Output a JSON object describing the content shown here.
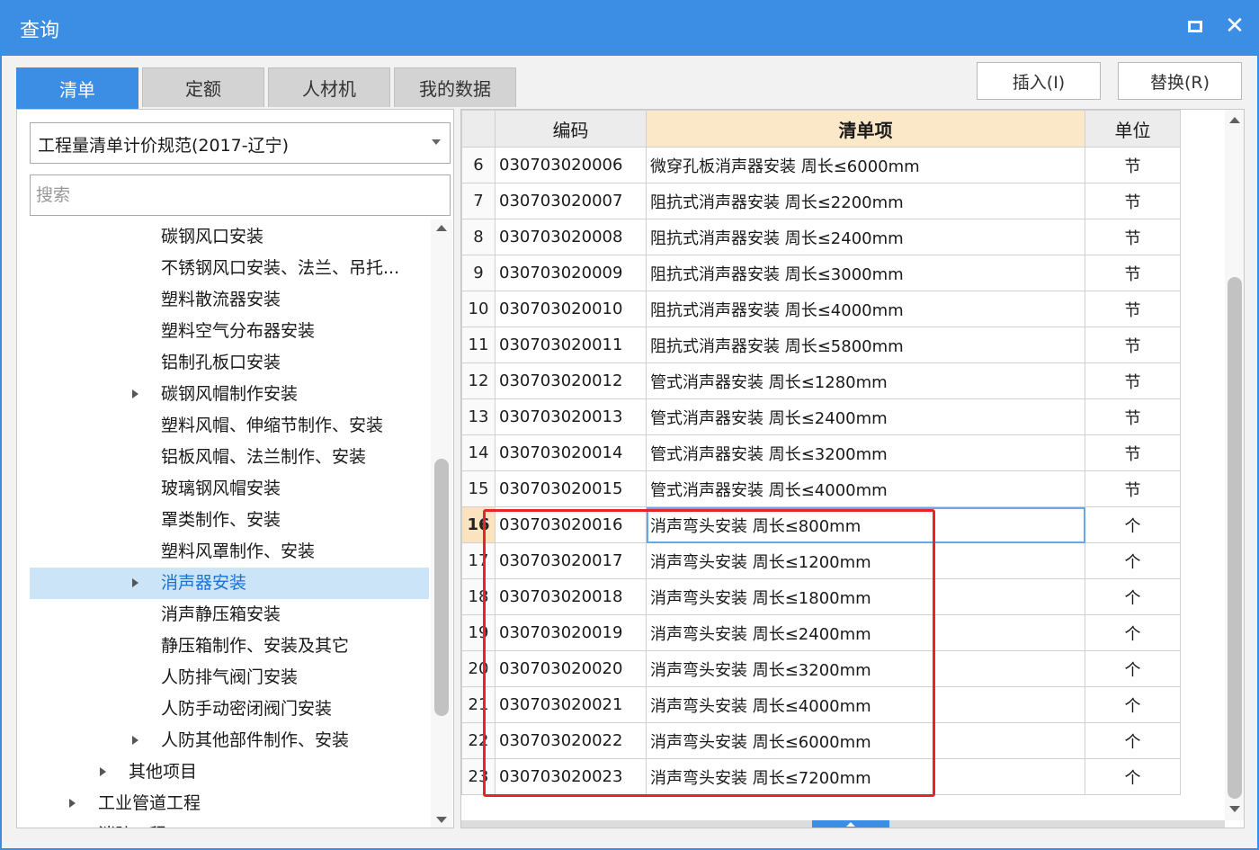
{
  "window": {
    "title": "查询"
  },
  "tabs": [
    {
      "label": "清单",
      "active": true
    },
    {
      "label": "定额",
      "active": false
    },
    {
      "label": "人材机",
      "active": false
    },
    {
      "label": "我的数据",
      "active": false
    }
  ],
  "actions": {
    "insert_label": "插入(I)",
    "replace_label": "替换(R)"
  },
  "left": {
    "spec_selected": "工程量清单计价规范(2017-辽宁)",
    "search_placeholder": "搜索",
    "tree": [
      {
        "label": "碳钢风口安装",
        "level": 3,
        "expandable": false,
        "selected": false
      },
      {
        "label": "不锈钢风口安装、法兰、吊托...",
        "level": 3,
        "expandable": false,
        "selected": false
      },
      {
        "label": "塑料散流器安装",
        "level": 3,
        "expandable": false,
        "selected": false
      },
      {
        "label": "塑料空气分布器安装",
        "level": 3,
        "expandable": false,
        "selected": false
      },
      {
        "label": "铝制孔板口安装",
        "level": 3,
        "expandable": false,
        "selected": false
      },
      {
        "label": "碳钢风帽制作安装",
        "level": 3,
        "expandable": true,
        "selected": false
      },
      {
        "label": "塑料风帽、伸缩节制作、安装",
        "level": 3,
        "expandable": false,
        "selected": false
      },
      {
        "label": "铝板风帽、法兰制作、安装",
        "level": 3,
        "expandable": false,
        "selected": false
      },
      {
        "label": "玻璃钢风帽安装",
        "level": 3,
        "expandable": false,
        "selected": false
      },
      {
        "label": "罩类制作、安装",
        "level": 3,
        "expandable": false,
        "selected": false
      },
      {
        "label": "塑料风罩制作、安装",
        "level": 3,
        "expandable": false,
        "selected": false
      },
      {
        "label": "消声器安装",
        "level": 3,
        "expandable": true,
        "selected": true
      },
      {
        "label": "消声静压箱安装",
        "level": 3,
        "expandable": false,
        "selected": false
      },
      {
        "label": "静压箱制作、安装及其它",
        "level": 3,
        "expandable": false,
        "selected": false
      },
      {
        "label": "人防排气阀门安装",
        "level": 3,
        "expandable": false,
        "selected": false
      },
      {
        "label": "人防手动密闭阀门安装",
        "level": 3,
        "expandable": false,
        "selected": false
      },
      {
        "label": "人防其他部件制作、安装",
        "level": 3,
        "expandable": true,
        "selected": false
      },
      {
        "label": "其他项目",
        "level": 2,
        "expandable": true,
        "selected": false
      },
      {
        "label": "工业管道工程",
        "level": 1,
        "expandable": true,
        "selected": false
      },
      {
        "label": "消防工程",
        "level": 1,
        "expandable": false,
        "selected": false
      }
    ]
  },
  "table": {
    "headers": {
      "num": "",
      "code": "编码",
      "item": "清单项",
      "unit": "单位"
    },
    "rows": [
      {
        "num": "6",
        "code": "030703020006",
        "name": "微穿孔板消声器安装 周长≤6000mm",
        "unit": "节"
      },
      {
        "num": "7",
        "code": "030703020007",
        "name": "阻抗式消声器安装 周长≤2200mm",
        "unit": "节"
      },
      {
        "num": "8",
        "code": "030703020008",
        "name": "阻抗式消声器安装 周长≤2400mm",
        "unit": "节"
      },
      {
        "num": "9",
        "code": "030703020009",
        "name": "阻抗式消声器安装 周长≤3000mm",
        "unit": "节"
      },
      {
        "num": "10",
        "code": "030703020010",
        "name": "阻抗式消声器安装 周长≤4000mm",
        "unit": "节"
      },
      {
        "num": "11",
        "code": "030703020011",
        "name": "阻抗式消声器安装 周长≤5800mm",
        "unit": "节"
      },
      {
        "num": "12",
        "code": "030703020012",
        "name": "管式消声器安装 周长≤1280mm",
        "unit": "节"
      },
      {
        "num": "13",
        "code": "030703020013",
        "name": "管式消声器安装 周长≤2400mm",
        "unit": "节"
      },
      {
        "num": "14",
        "code": "030703020014",
        "name": "管式消声器安装 周长≤3200mm",
        "unit": "节"
      },
      {
        "num": "15",
        "code": "030703020015",
        "name": "管式消声器安装 周长≤4000mm",
        "unit": "节"
      },
      {
        "num": "16",
        "code": "030703020016",
        "name": "消声弯头安装 周长≤800mm",
        "unit": "个",
        "current": true
      },
      {
        "num": "17",
        "code": "030703020017",
        "name": "消声弯头安装 周长≤1200mm",
        "unit": "个"
      },
      {
        "num": "18",
        "code": "030703020018",
        "name": "消声弯头安装 周长≤1800mm",
        "unit": "个"
      },
      {
        "num": "19",
        "code": "030703020019",
        "name": "消声弯头安装 周长≤2400mm",
        "unit": "个"
      },
      {
        "num": "20",
        "code": "030703020020",
        "name": "消声弯头安装 周长≤3200mm",
        "unit": "个"
      },
      {
        "num": "21",
        "code": "030703020021",
        "name": "消声弯头安装 周长≤4000mm",
        "unit": "个"
      },
      {
        "num": "22",
        "code": "030703020022",
        "name": "消声弯头安装 周长≤6000mm",
        "unit": "个"
      },
      {
        "num": "23",
        "code": "030703020023",
        "name": "消声弯头安装 周长≤7200mm",
        "unit": "个"
      }
    ]
  },
  "colors": {
    "accent": "#3c8de4",
    "header_highlight": "#fbe8c8",
    "selection": "#cce4f7",
    "annotation": "#e8242a"
  },
  "icons": {
    "maximize": "maximize-icon",
    "close": "close-icon",
    "dropdown": "chevron-down-icon",
    "expand": "triangle-right-icon"
  }
}
